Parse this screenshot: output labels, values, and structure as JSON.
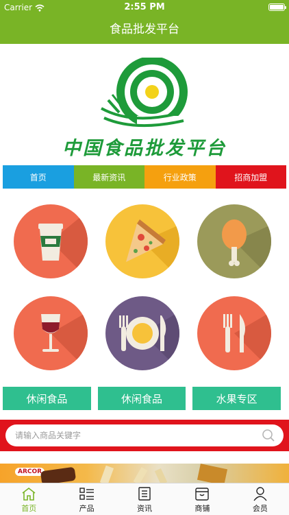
{
  "status_bar": {
    "carrier": "Carrier",
    "time": "2:55 PM"
  },
  "header": {
    "title": "食品批发平台"
  },
  "logo": {
    "text": "中国食品批发平台"
  },
  "tabs": [
    {
      "label": "首页",
      "color": "#1a9fe0"
    },
    {
      "label": "最新资讯",
      "color": "#79b426"
    },
    {
      "label": "行业政策",
      "color": "#f5a00f"
    },
    {
      "label": "招商加盟",
      "color": "#e0141c"
    }
  ],
  "categories": [
    {
      "icon": "coffee-cup-icon",
      "bg": "#f06b4f"
    },
    {
      "icon": "pizza-slice-icon",
      "bg": "#f7c23a"
    },
    {
      "icon": "chicken-leg-icon",
      "bg": "#9b9a5a"
    },
    {
      "icon": "wine-glass-icon",
      "bg": "#f06b4f"
    },
    {
      "icon": "plate-fork-knife-icon",
      "bg": "#6e5a86"
    },
    {
      "icon": "fork-knife-icon",
      "bg": "#f06b4f"
    }
  ],
  "pills": [
    {
      "label": "休闲食品"
    },
    {
      "label": "休闲食品"
    },
    {
      "label": "水果专区"
    }
  ],
  "search": {
    "placeholder": "请输入商品关键字"
  },
  "banner": {
    "brand": "ARCOR"
  },
  "tabbar": [
    {
      "label": "首页",
      "icon": "home-icon",
      "active": true
    },
    {
      "label": "产品",
      "icon": "list-icon",
      "active": false
    },
    {
      "label": "资讯",
      "icon": "news-icon",
      "active": false
    },
    {
      "label": "商铺",
      "icon": "store-icon",
      "active": false
    },
    {
      "label": "会员",
      "icon": "user-icon",
      "active": false
    }
  ],
  "colors": {
    "primary": "#79b426",
    "search_band": "#e0141c",
    "pill": "#2fbf8f"
  }
}
